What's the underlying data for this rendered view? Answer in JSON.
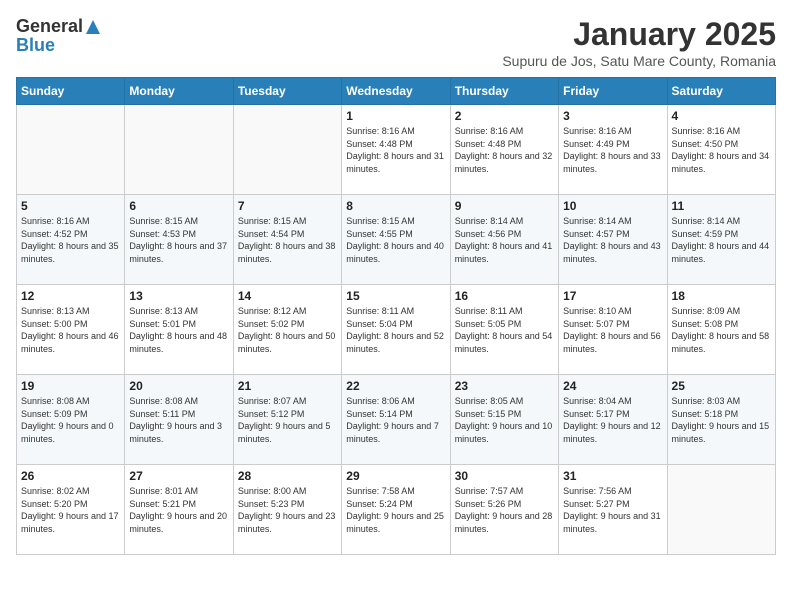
{
  "logo": {
    "general": "General",
    "blue": "Blue"
  },
  "header": {
    "month": "January 2025",
    "location": "Supuru de Jos, Satu Mare County, Romania"
  },
  "weekdays": [
    "Sunday",
    "Monday",
    "Tuesday",
    "Wednesday",
    "Thursday",
    "Friday",
    "Saturday"
  ],
  "weeks": [
    [
      {
        "day": "",
        "sunrise": "",
        "sunset": "",
        "daylight": ""
      },
      {
        "day": "",
        "sunrise": "",
        "sunset": "",
        "daylight": ""
      },
      {
        "day": "",
        "sunrise": "",
        "sunset": "",
        "daylight": ""
      },
      {
        "day": "1",
        "sunrise": "Sunrise: 8:16 AM",
        "sunset": "Sunset: 4:48 PM",
        "daylight": "Daylight: 8 hours and 31 minutes."
      },
      {
        "day": "2",
        "sunrise": "Sunrise: 8:16 AM",
        "sunset": "Sunset: 4:48 PM",
        "daylight": "Daylight: 8 hours and 32 minutes."
      },
      {
        "day": "3",
        "sunrise": "Sunrise: 8:16 AM",
        "sunset": "Sunset: 4:49 PM",
        "daylight": "Daylight: 8 hours and 33 minutes."
      },
      {
        "day": "4",
        "sunrise": "Sunrise: 8:16 AM",
        "sunset": "Sunset: 4:50 PM",
        "daylight": "Daylight: 8 hours and 34 minutes."
      }
    ],
    [
      {
        "day": "5",
        "sunrise": "Sunrise: 8:16 AM",
        "sunset": "Sunset: 4:52 PM",
        "daylight": "Daylight: 8 hours and 35 minutes."
      },
      {
        "day": "6",
        "sunrise": "Sunrise: 8:15 AM",
        "sunset": "Sunset: 4:53 PM",
        "daylight": "Daylight: 8 hours and 37 minutes."
      },
      {
        "day": "7",
        "sunrise": "Sunrise: 8:15 AM",
        "sunset": "Sunset: 4:54 PM",
        "daylight": "Daylight: 8 hours and 38 minutes."
      },
      {
        "day": "8",
        "sunrise": "Sunrise: 8:15 AM",
        "sunset": "Sunset: 4:55 PM",
        "daylight": "Daylight: 8 hours and 40 minutes."
      },
      {
        "day": "9",
        "sunrise": "Sunrise: 8:14 AM",
        "sunset": "Sunset: 4:56 PM",
        "daylight": "Daylight: 8 hours and 41 minutes."
      },
      {
        "day": "10",
        "sunrise": "Sunrise: 8:14 AM",
        "sunset": "Sunset: 4:57 PM",
        "daylight": "Daylight: 8 hours and 43 minutes."
      },
      {
        "day": "11",
        "sunrise": "Sunrise: 8:14 AM",
        "sunset": "Sunset: 4:59 PM",
        "daylight": "Daylight: 8 hours and 44 minutes."
      }
    ],
    [
      {
        "day": "12",
        "sunrise": "Sunrise: 8:13 AM",
        "sunset": "Sunset: 5:00 PM",
        "daylight": "Daylight: 8 hours and 46 minutes."
      },
      {
        "day": "13",
        "sunrise": "Sunrise: 8:13 AM",
        "sunset": "Sunset: 5:01 PM",
        "daylight": "Daylight: 8 hours and 48 minutes."
      },
      {
        "day": "14",
        "sunrise": "Sunrise: 8:12 AM",
        "sunset": "Sunset: 5:02 PM",
        "daylight": "Daylight: 8 hours and 50 minutes."
      },
      {
        "day": "15",
        "sunrise": "Sunrise: 8:11 AM",
        "sunset": "Sunset: 5:04 PM",
        "daylight": "Daylight: 8 hours and 52 minutes."
      },
      {
        "day": "16",
        "sunrise": "Sunrise: 8:11 AM",
        "sunset": "Sunset: 5:05 PM",
        "daylight": "Daylight: 8 hours and 54 minutes."
      },
      {
        "day": "17",
        "sunrise": "Sunrise: 8:10 AM",
        "sunset": "Sunset: 5:07 PM",
        "daylight": "Daylight: 8 hours and 56 minutes."
      },
      {
        "day": "18",
        "sunrise": "Sunrise: 8:09 AM",
        "sunset": "Sunset: 5:08 PM",
        "daylight": "Daylight: 8 hours and 58 minutes."
      }
    ],
    [
      {
        "day": "19",
        "sunrise": "Sunrise: 8:08 AM",
        "sunset": "Sunset: 5:09 PM",
        "daylight": "Daylight: 9 hours and 0 minutes."
      },
      {
        "day": "20",
        "sunrise": "Sunrise: 8:08 AM",
        "sunset": "Sunset: 5:11 PM",
        "daylight": "Daylight: 9 hours and 3 minutes."
      },
      {
        "day": "21",
        "sunrise": "Sunrise: 8:07 AM",
        "sunset": "Sunset: 5:12 PM",
        "daylight": "Daylight: 9 hours and 5 minutes."
      },
      {
        "day": "22",
        "sunrise": "Sunrise: 8:06 AM",
        "sunset": "Sunset: 5:14 PM",
        "daylight": "Daylight: 9 hours and 7 minutes."
      },
      {
        "day": "23",
        "sunrise": "Sunrise: 8:05 AM",
        "sunset": "Sunset: 5:15 PM",
        "daylight": "Daylight: 9 hours and 10 minutes."
      },
      {
        "day": "24",
        "sunrise": "Sunrise: 8:04 AM",
        "sunset": "Sunset: 5:17 PM",
        "daylight": "Daylight: 9 hours and 12 minutes."
      },
      {
        "day": "25",
        "sunrise": "Sunrise: 8:03 AM",
        "sunset": "Sunset: 5:18 PM",
        "daylight": "Daylight: 9 hours and 15 minutes."
      }
    ],
    [
      {
        "day": "26",
        "sunrise": "Sunrise: 8:02 AM",
        "sunset": "Sunset: 5:20 PM",
        "daylight": "Daylight: 9 hours and 17 minutes."
      },
      {
        "day": "27",
        "sunrise": "Sunrise: 8:01 AM",
        "sunset": "Sunset: 5:21 PM",
        "daylight": "Daylight: 9 hours and 20 minutes."
      },
      {
        "day": "28",
        "sunrise": "Sunrise: 8:00 AM",
        "sunset": "Sunset: 5:23 PM",
        "daylight": "Daylight: 9 hours and 23 minutes."
      },
      {
        "day": "29",
        "sunrise": "Sunrise: 7:58 AM",
        "sunset": "Sunset: 5:24 PM",
        "daylight": "Daylight: 9 hours and 25 minutes."
      },
      {
        "day": "30",
        "sunrise": "Sunrise: 7:57 AM",
        "sunset": "Sunset: 5:26 PM",
        "daylight": "Daylight: 9 hours and 28 minutes."
      },
      {
        "day": "31",
        "sunrise": "Sunrise: 7:56 AM",
        "sunset": "Sunset: 5:27 PM",
        "daylight": "Daylight: 9 hours and 31 minutes."
      },
      {
        "day": "",
        "sunrise": "",
        "sunset": "",
        "daylight": ""
      }
    ]
  ]
}
